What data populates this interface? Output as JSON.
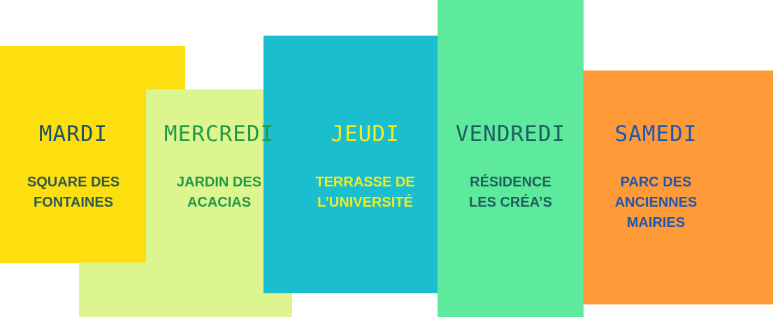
{
  "colors": {
    "mardi_bg": "#FDDE0F",
    "mardi_title": "#1E5266",
    "mardi_text": "#2A5A4E",
    "mercredi_bg": "#DDF58E",
    "mercredi_text": "#1E9A47",
    "jeudi_bg": "#1ABECF",
    "jeudi_text": "#F4EC1F",
    "vendredi_bg": "#5EEA9D",
    "vendredi_text": "#1E5E5E",
    "samedi_bg": "#FE9B38",
    "samedi_text": "#1F56AE"
  },
  "schedule": [
    {
      "day": "MARDI",
      "location_lines": [
        "SQUARE DES",
        "FONTAINES"
      ]
    },
    {
      "day": "MERCREDI",
      "location_lines": [
        "JARDIN DES",
        "ACACIAS"
      ]
    },
    {
      "day": "JEUDI",
      "location_lines": [
        "TERRASSE DE",
        "L’UNIVERSITÉ"
      ]
    },
    {
      "day": "VENDREDI",
      "location_lines": [
        "RÉSIDENCE",
        "LES CRÉA’S"
      ]
    },
    {
      "day": "SAMEDI",
      "location_lines": [
        "PARC DES",
        "ANCIENNES",
        "MAIRIES"
      ]
    }
  ]
}
